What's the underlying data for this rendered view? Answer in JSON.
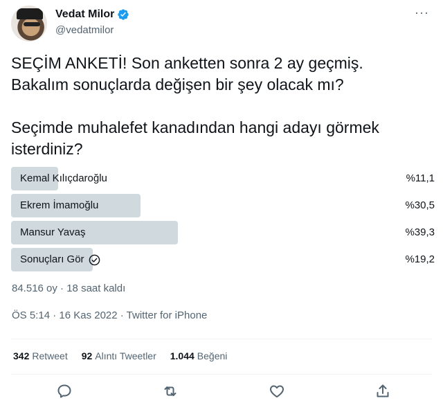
{
  "author": {
    "display_name": "Vedat Milor",
    "handle": "@vedatmilor",
    "verified_icon": "verified-badge-icon"
  },
  "more_label": "···",
  "tweet": {
    "line1": "SEÇİM ANKETİ! Son anketten sonra 2 ay geçmiş.",
    "line2": "Bakalım sonuçlarda değişen bir şey olacak mı?",
    "line3": "Seçimde muhalefet kanadından hangi adayı görmek",
    "line4": "isterdiniz?"
  },
  "poll": {
    "options": [
      {
        "label": "Kemal Kılıçdaroğlu",
        "percent_text": "%11,1",
        "percent": 11.1
      },
      {
        "label": "Ekrem İmamoğlu",
        "percent_text": "%30,5",
        "percent": 30.5
      },
      {
        "label": "Mansur Yavaş",
        "percent_text": "%39,3",
        "percent": 39.3
      },
      {
        "label": "Sonuçları Gör",
        "percent_text": "%19,2",
        "percent": 19.2,
        "icon": "check-circle-icon"
      }
    ],
    "meta": "84.516 oy · 18 saat kaldı"
  },
  "timestamp": "ÖS 5:14 · 16 Kas 2022 · Twitter for iPhone",
  "stats": {
    "retweets_count": "342",
    "retweets_label": "Retweet",
    "quotes_count": "92",
    "quotes_label": "Alıntı Tweetler",
    "likes_count": "1.044",
    "likes_label": "Beğeni"
  },
  "actions": [
    "reply-icon",
    "retweet-icon",
    "like-icon",
    "share-icon"
  ],
  "colors": {
    "bar": "#cfd9de",
    "verified": "#1d9bf0",
    "secondary_text": "#536471"
  }
}
